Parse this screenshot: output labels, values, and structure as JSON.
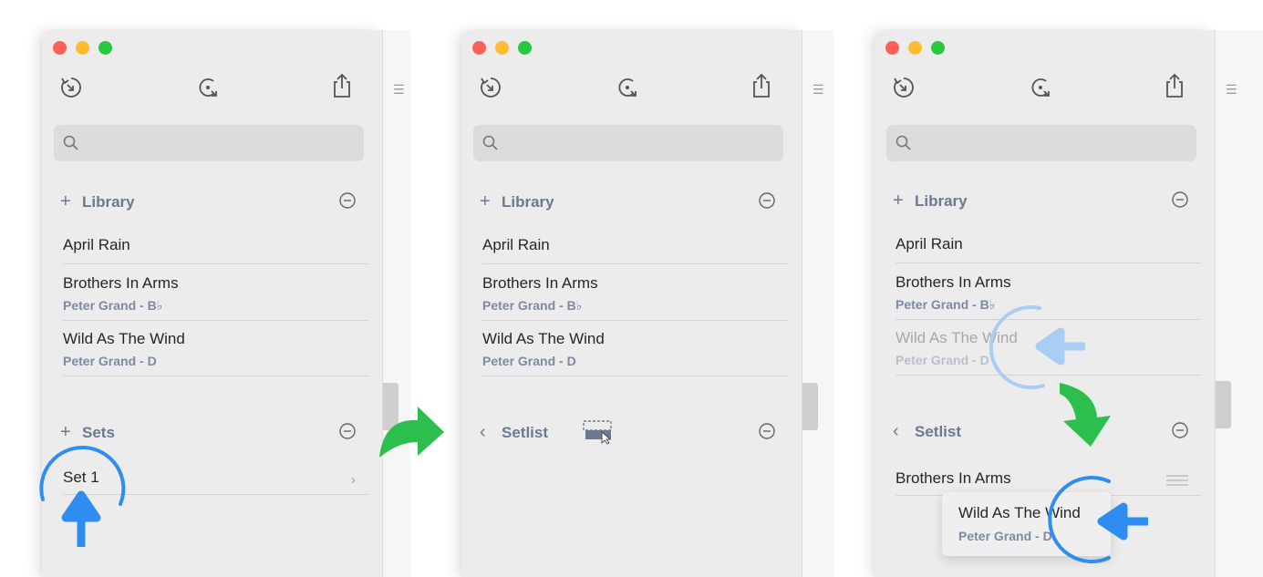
{
  "colors": {
    "close": "#ff5f57",
    "minimize": "#febc2e",
    "zoom": "#28c840",
    "section_text": "#6b7a90",
    "subtitle": "#7d8aa3",
    "annotation_blue": "#2f8cf0",
    "annotation_green": "#2dbf4e"
  },
  "icons": {
    "sync_left": "sync-left-icon",
    "sync_right": "sync-right-icon",
    "share": "share-icon",
    "search": "search-icon",
    "sidebar_menu": "sidebar-menu-icon"
  },
  "panels": [
    {
      "library": {
        "label": "Library",
        "items": [
          {
            "title": "April Rain",
            "subtitle": ""
          },
          {
            "title": "Brothers In Arms",
            "subtitle": "Peter Grand - B♭"
          },
          {
            "title": "Wild As The Wind",
            "subtitle": "Peter Grand - D"
          }
        ]
      },
      "sets": {
        "label": "Sets",
        "items": [
          {
            "title": "Set 1"
          }
        ]
      }
    },
    {
      "library": {
        "label": "Library",
        "items": [
          {
            "title": "April Rain",
            "subtitle": ""
          },
          {
            "title": "Brothers In Arms",
            "subtitle": "Peter Grand - B♭"
          },
          {
            "title": "Wild As The Wind",
            "subtitle": "Peter Grand - D"
          }
        ]
      },
      "setlist": {
        "label": "Setlist"
      }
    },
    {
      "library": {
        "label": "Library",
        "items": [
          {
            "title": "April Rain",
            "subtitle": ""
          },
          {
            "title": "Brothers In Arms",
            "subtitle": "Peter Grand - B♭"
          },
          {
            "title": "Wild As The Wind",
            "subtitle": "Peter Grand - D"
          }
        ]
      },
      "setlist": {
        "label": "Setlist",
        "items": [
          {
            "title": "Brothers In Arms"
          }
        ],
        "dragging": {
          "title": "Wild As The Wind",
          "subtitle": "Peter Grand - D"
        }
      }
    }
  ]
}
